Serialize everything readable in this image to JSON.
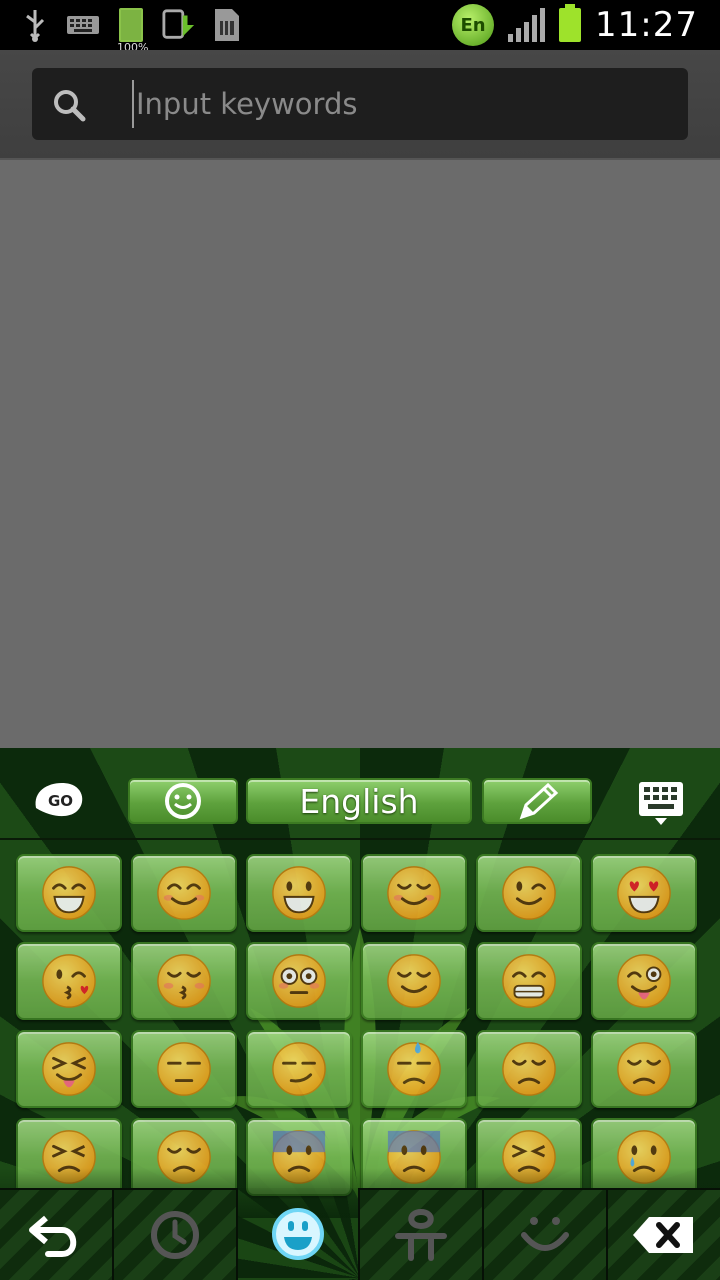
{
  "status_bar": {
    "battery_label": "100%",
    "language_badge": "En",
    "time": "11:27",
    "icons": [
      "usb-icon",
      "keyboard-icon",
      "battery-charged-icon",
      "upload-icon",
      "sim-icon",
      "go-keyboard-en-icon",
      "signal-icon",
      "battery-icon"
    ]
  },
  "search": {
    "placeholder": "Input keywords",
    "value": ""
  },
  "keyboard": {
    "theme_color": "#5ea23d",
    "top_bar": {
      "go_label": "GO",
      "language": "English",
      "icons": [
        "go-logo-icon",
        "emoji-face-icon",
        "pencil-icon",
        "keyboard-switch-icon"
      ]
    },
    "emoji_rows": [
      [
        "grinning",
        "smiling-blush",
        "smiley",
        "relaxed",
        "wink",
        "heart-eyes"
      ],
      [
        "kissing-heart",
        "kissing-closed-eyes",
        "flushed",
        "relieved",
        "grimacing",
        "stuck-out-tongue-wink"
      ],
      [
        "tongue-closed-eyes",
        "unamused",
        "smirk",
        "sweat",
        "pensive",
        "disappointed"
      ],
      [
        "confounded",
        "disappointed-relieved",
        "fearful",
        "cold-sweat",
        "persevere",
        "cry"
      ]
    ],
    "bottom_bar": {
      "items": [
        "back-arrow-icon",
        "recent-clock-icon",
        "emoji-smile-icon",
        "text-emoticon-icon",
        "kaomoji-smile-icon",
        "delete-icon"
      ],
      "selected_index": 2
    }
  }
}
